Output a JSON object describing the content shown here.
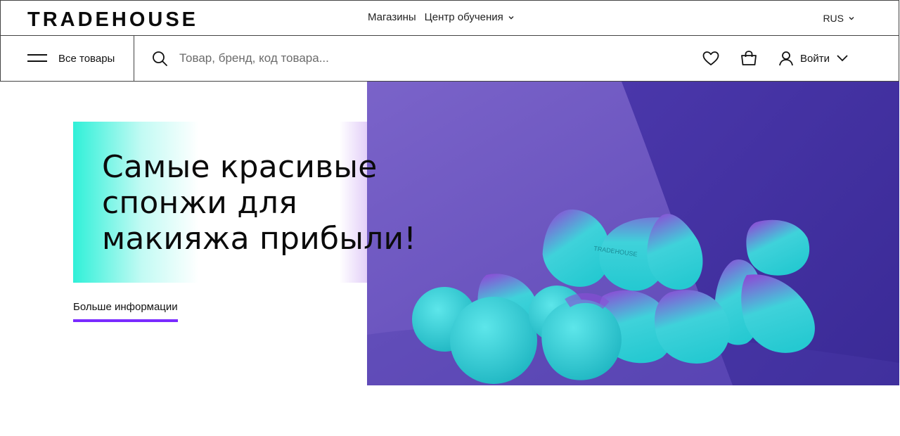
{
  "header": {
    "logo_text": "TRADEHOUSE",
    "nav": [
      {
        "label": "Магазины"
      },
      {
        "label": "Центр обучения"
      }
    ],
    "language": "RUS"
  },
  "toolbar": {
    "all_products_label": "Все товары",
    "search_placeholder": "Товар, бренд, код товара...",
    "login_label": "Войти"
  },
  "hero": {
    "title": "Самые красивые спонжи для макияжа прибыли!",
    "more_link": "Больше информации",
    "image_brand_text": "TRADEHOUSE"
  },
  "colors": {
    "accent_purple": "#7a2bff",
    "gradient_teal": "#2ff0d8",
    "gradient_pink": "#d35cff",
    "hero_bg_purple": "#4b3aa8",
    "sponge_teal": "#39d6dc"
  }
}
